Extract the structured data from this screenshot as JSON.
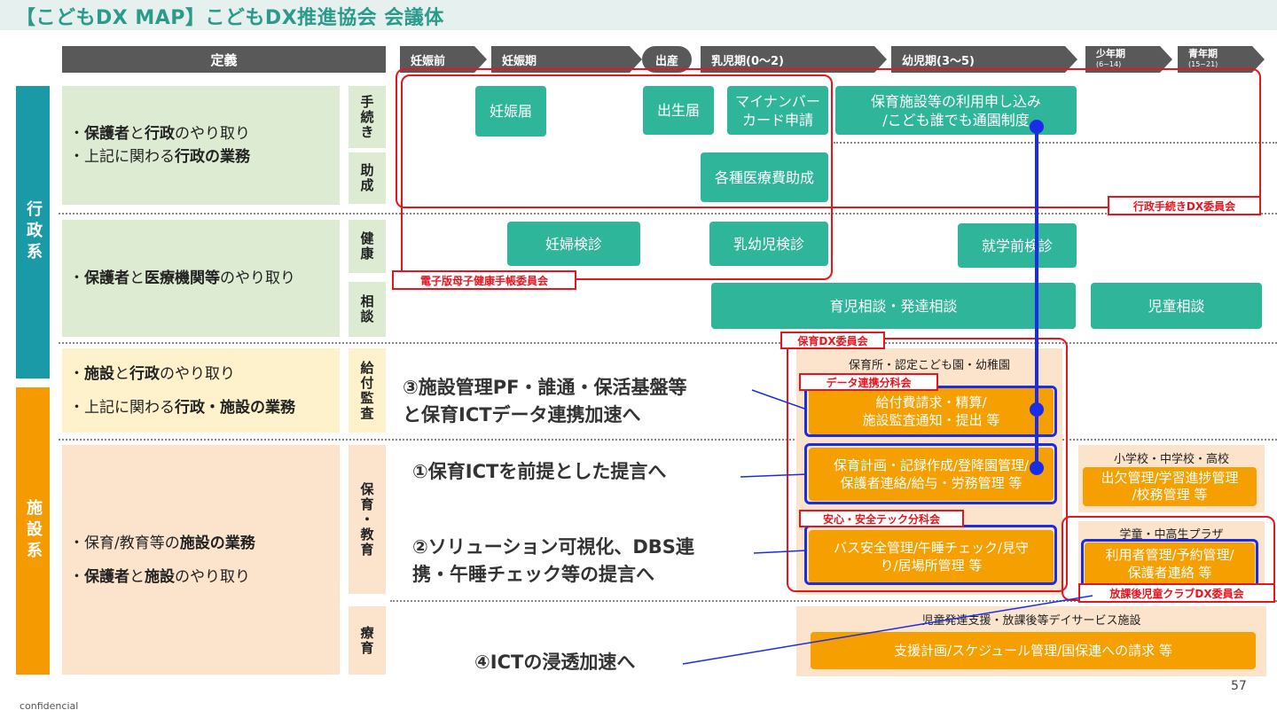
{
  "title": "【こどもDX MAP】こどもDX推進協会 会議体",
  "header": {
    "definition": "定義",
    "stages": [
      "妊娠前",
      "妊娠期",
      "出産",
      "乳児期(0〜2)",
      "幼児期(3〜5)"
    ],
    "youth": {
      "label": "少年期",
      "range": "(6~14)"
    },
    "adolescent": {
      "label": "青年期",
      "range": "(15~21)"
    }
  },
  "categories": {
    "admin": "行政系",
    "facility": "施設系"
  },
  "definitions": {
    "row1": {
      "l1a": "保護者",
      "l1b": "と",
      "l1c": "行政",
      "l1d": "のやり取り",
      "l2a": "上記に関わる",
      "l2b": "行政の業務"
    },
    "row2": {
      "l1a": "保護者",
      "l1b": "と",
      "l1c": "医療機関等",
      "l1d": "のやり取り"
    },
    "row3": {
      "l1a": "施設",
      "l1b": "と",
      "l1c": "行政",
      "l1d": "のやり取り",
      "l2a": "上記に関わる",
      "l2b": "行政・施設の業務"
    },
    "row4": {
      "l1a": "保育/教育等の",
      "l1b": "施設の業務",
      "l2a": "保護者",
      "l2b": "と",
      "l2c": "施設",
      "l2d": "のやり取り"
    },
    "bullet": "・"
  },
  "subcategories": {
    "procedures": "手続き",
    "subsidy": "助成",
    "health": "健康",
    "consult": "相談",
    "payment": "給付監査",
    "childcare": "保育・教育",
    "therapy": "療育"
  },
  "items": {
    "pregnancy_report": "妊娠届",
    "birth_report": "出生届",
    "mynumber_line1": "マイナンバー",
    "mynumber_line2": "カード申請",
    "nursery_apply_line1": "保育施設等の利用申し込み",
    "nursery_apply_line2": "/こども誰でも通園制度",
    "medical_subsidy": "各種医療費助成",
    "maternal_checkup": "妊婦検診",
    "infant_checkup": "乳幼児検診",
    "preschool_checkup": "就学前検診",
    "child_consult": "育児相談・発達相談",
    "youth_consult": "児童相談",
    "payment_line1": "給付費請求・精算/",
    "payment_line2": "施設監査通知・提出 等",
    "childcare_line1": "保育計画・記録作成/登降園管理/",
    "childcare_line2": "保護者連絡/給与・労務管理 等",
    "bus_line1": "バス安全管理/午睡チェック/見守",
    "bus_line2": "り/居場所管理 等",
    "school_line1": "出欠管理/学習進捗管理",
    "school_line2": "/校務管理 等",
    "afterschool_line1": "利用者管理/予約管理/",
    "afterschool_line2": "保護者連絡 等",
    "therapy_service": "支援計画/スケジュール管理/国保連への請求 等"
  },
  "facility_labels": {
    "nursery": "保育所・認定こども園・幼稚園",
    "school": "小学校・中学校・高校",
    "afterschool": "学童・中高生プラザ",
    "therapy": "児童発達支援・放課後等デイサービス施設"
  },
  "committees": {
    "admin_dx": "行政手続きDX委員会",
    "maternal_app": "電子版母子健康手帳委員会",
    "nursery_dx": "保育DX委員会",
    "data_link": "データ連携分科会",
    "safety_tech": "安心・安全テック分科会",
    "afterschool_dx": "放課後児童クラブDX委員会"
  },
  "proposals": {
    "p3_line1": "③施設管理PF・誰通・保活基盤等",
    "p3_line2": "と保育ICTデータ連携加速へ",
    "p1": "①保育ICTを前提とした提言へ",
    "p2_line1": "②ソリューション可視化、DBS連",
    "p2_line2": "携・午睡チェック等の提言へ",
    "p4": "④ICTの浸透加速へ"
  },
  "footer": {
    "confidential": "confidencial",
    "page": "57"
  },
  "colors": {
    "teal": "#2fb59a",
    "orange": "#f5a000",
    "red": "#e8141e",
    "blue": "#1a2ce8",
    "admin_cat": "#1a9aa6",
    "facility_cat": "#f59a00"
  }
}
